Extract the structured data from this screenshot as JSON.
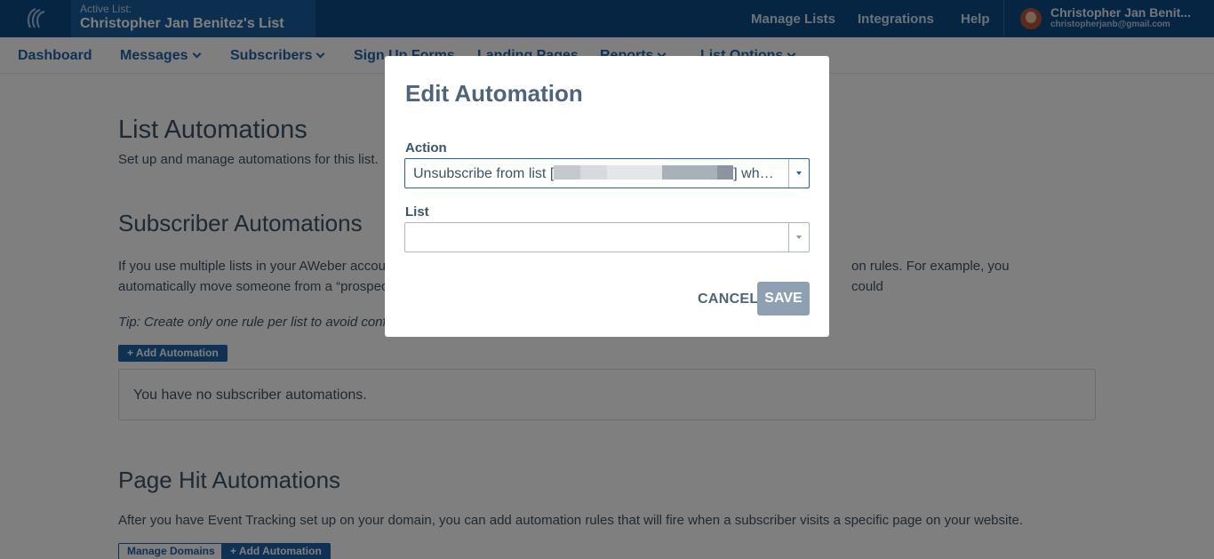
{
  "topbar": {
    "active_list_label": "Active List:",
    "active_list_name": "Christopher Jan Benitez's List",
    "nav": [
      "Manage Lists",
      "Integrations",
      "Help"
    ],
    "user_name": "Christopher Jan Benit...",
    "user_email": "christopherjanb@gmail.com"
  },
  "subnav": {
    "items": [
      "Dashboard",
      "Messages",
      "Subscribers",
      "Sign Up Forms",
      "Landing Pages",
      "Reports",
      "List Options"
    ]
  },
  "page": {
    "title": "List Automations",
    "subtitle": "Set up and manage automations for this list.",
    "subscriber_heading": "Subscriber Automations",
    "subscriber_text_1": "If you use multiple lists in your AWeber accoun",
    "subscriber_text_1_end": "on rules. For example, you could",
    "subscriber_text_2": "automatically move someone from a “prospec",
    "tip": "Tip: Create only one rule per list to avoid confi",
    "add_automation": "+ Add Automation",
    "empty_message": "You have no subscriber automations.",
    "pagehit_heading": "Page Hit Automations",
    "pagehit_text": "After you have Event Tracking set up on your domain, you can add automation rules that will fire when a subscriber visits a specific page on your website.",
    "manage_domains": "Manage Domains",
    "add_automation_2": "+ Add Automation"
  },
  "modal": {
    "title": "Edit Automation",
    "action_label": "Action",
    "action_value_prefix": "Unsubscribe from list [",
    "action_value_suffix": "] wh…",
    "list_label": "List",
    "list_value": "",
    "cancel": "CANCEL",
    "save": "SAVE"
  },
  "colors": {
    "topbar": "#0a4a86",
    "accent": "#1f63a8",
    "save_disabled": "#8fa0b3"
  }
}
